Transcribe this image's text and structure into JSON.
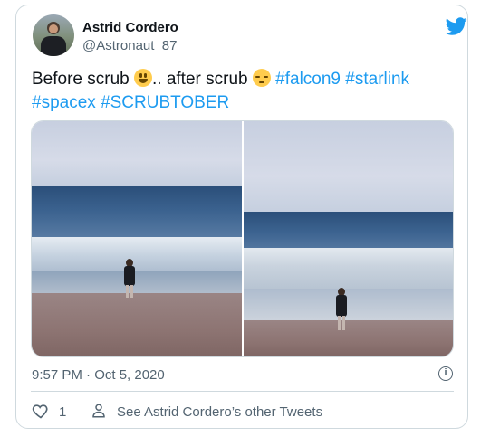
{
  "author": {
    "name": "Astrid Cordero",
    "handle": "@Astronaut_87"
  },
  "tweet": {
    "text_part1": "Before scrub ",
    "text_part2": ".. after scrub ",
    "hashtags_line1": [
      "#falcon9",
      "#starlink"
    ],
    "hashtags_line2": [
      "#spacex",
      "#SCRUBTOBER"
    ],
    "emoji1": "grinning-face-emoji",
    "emoji2": "pensive-face-emoji"
  },
  "timestamp": "9:57 PM · Oct 5, 2020",
  "footer": {
    "like_count": "1",
    "other_tweets_label": "See Astrid Cordero’s other Tweets"
  },
  "colors": {
    "accent": "#1d9bf0",
    "secondary_text": "#536471",
    "border": "#cfd9de"
  }
}
